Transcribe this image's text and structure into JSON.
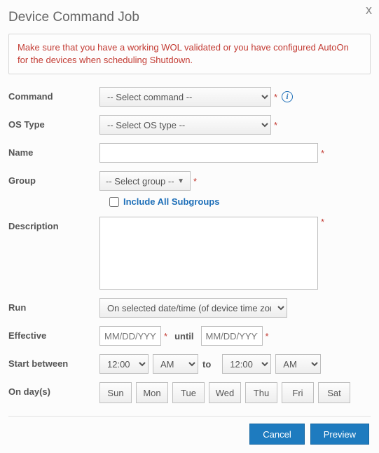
{
  "dialog": {
    "title": "Device Command Job",
    "close_glyph": "x",
    "warning": "Make sure that you have a working WOL validated or you have configured AutoOn for the devices when scheduling Shutdown."
  },
  "labels": {
    "command": "Command",
    "os_type": "OS Type",
    "name": "Name",
    "group": "Group",
    "include_subgroups": "Include All Subgroups",
    "description": "Description",
    "run": "Run",
    "effective": "Effective",
    "until": "until",
    "start_between": "Start between",
    "to": "to",
    "on_days": "On day(s)"
  },
  "fields": {
    "command_placeholder": "-- Select command --",
    "os_type_placeholder": "-- Select OS type --",
    "name_value": "",
    "group_placeholder": "-- Select group --",
    "include_subgroups_checked": false,
    "description_value": "",
    "run_value": "On selected date/time (of device time zone)",
    "date_placeholder": "MM/DD/YYYY",
    "effective_from": "",
    "effective_until": "",
    "time_from": "12:00",
    "ampm_from": "AM",
    "time_to": "12:00",
    "ampm_to": "AM"
  },
  "days": [
    "Sun",
    "Mon",
    "Tue",
    "Wed",
    "Thu",
    "Fri",
    "Sat"
  ],
  "buttons": {
    "cancel": "Cancel",
    "preview": "Preview"
  },
  "required_marker": "*",
  "info_glyph": "i"
}
